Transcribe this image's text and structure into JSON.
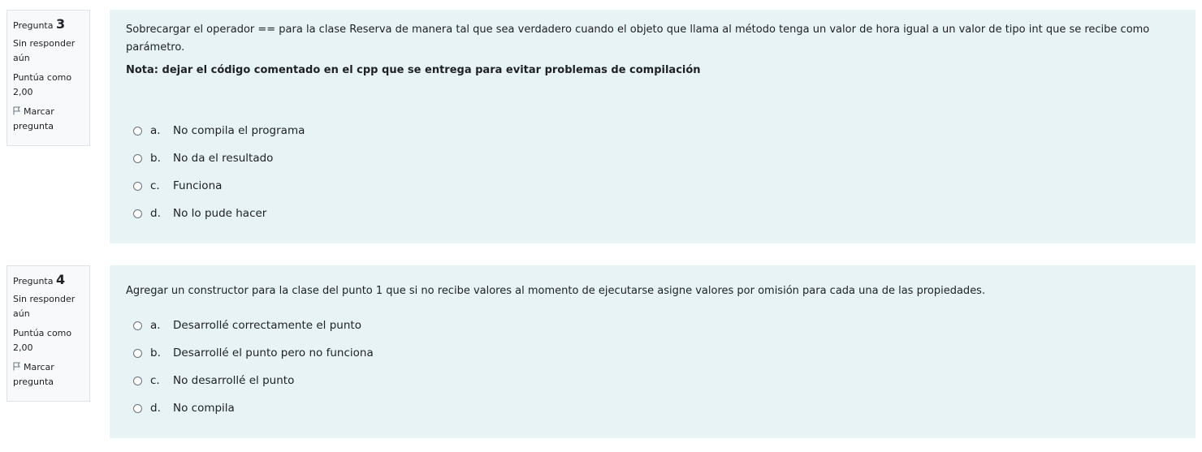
{
  "questions": [
    {
      "label": "Pregunta",
      "number": "3",
      "state": "Sin responder aún",
      "grade": "Puntúa como 2,00",
      "flag_label": "Marcar pregunta",
      "text": "Sobrecargar el operador == para la clase Reserva de manera tal que sea verdadero cuando el objeto que llama al método tenga un valor de hora igual a un valor de tipo int que se recibe como parámetro.",
      "note": "Nota: dejar el código comentado en el cpp que se entrega para evitar problemas de compilación",
      "answers": [
        {
          "letter": "a.",
          "text": "No compila el programa"
        },
        {
          "letter": "b.",
          "text": "No da el resultado"
        },
        {
          "letter": "c.",
          "text": "Funciona"
        },
        {
          "letter": "d.",
          "text": "No lo pude hacer"
        }
      ]
    },
    {
      "label": "Pregunta",
      "number": "4",
      "state": "Sin responder aún",
      "grade": "Puntúa como 2,00",
      "flag_label": "Marcar pregunta",
      "text": "Agregar un constructor para la clase del punto 1 que si no recibe valores al momento de ejecutarse asigne valores por omisión para cada una de las propiedades.",
      "answers": [
        {
          "letter": "a.",
          "text": "Desarrollé correctamente el punto"
        },
        {
          "letter": "b.",
          "text": "Desarrollé el punto pero no funciona"
        },
        {
          "letter": "c.",
          "text": "No desarrollé el punto"
        },
        {
          "letter": "d.",
          "text": "No compila"
        }
      ]
    }
  ],
  "icons": {
    "flag": "flag-icon",
    "radio": "radio-unchecked-icon"
  },
  "colors": {
    "content_bg": "#e7f3f5",
    "info_bg": "#f8f9fa",
    "info_border": "#dee2e6"
  }
}
